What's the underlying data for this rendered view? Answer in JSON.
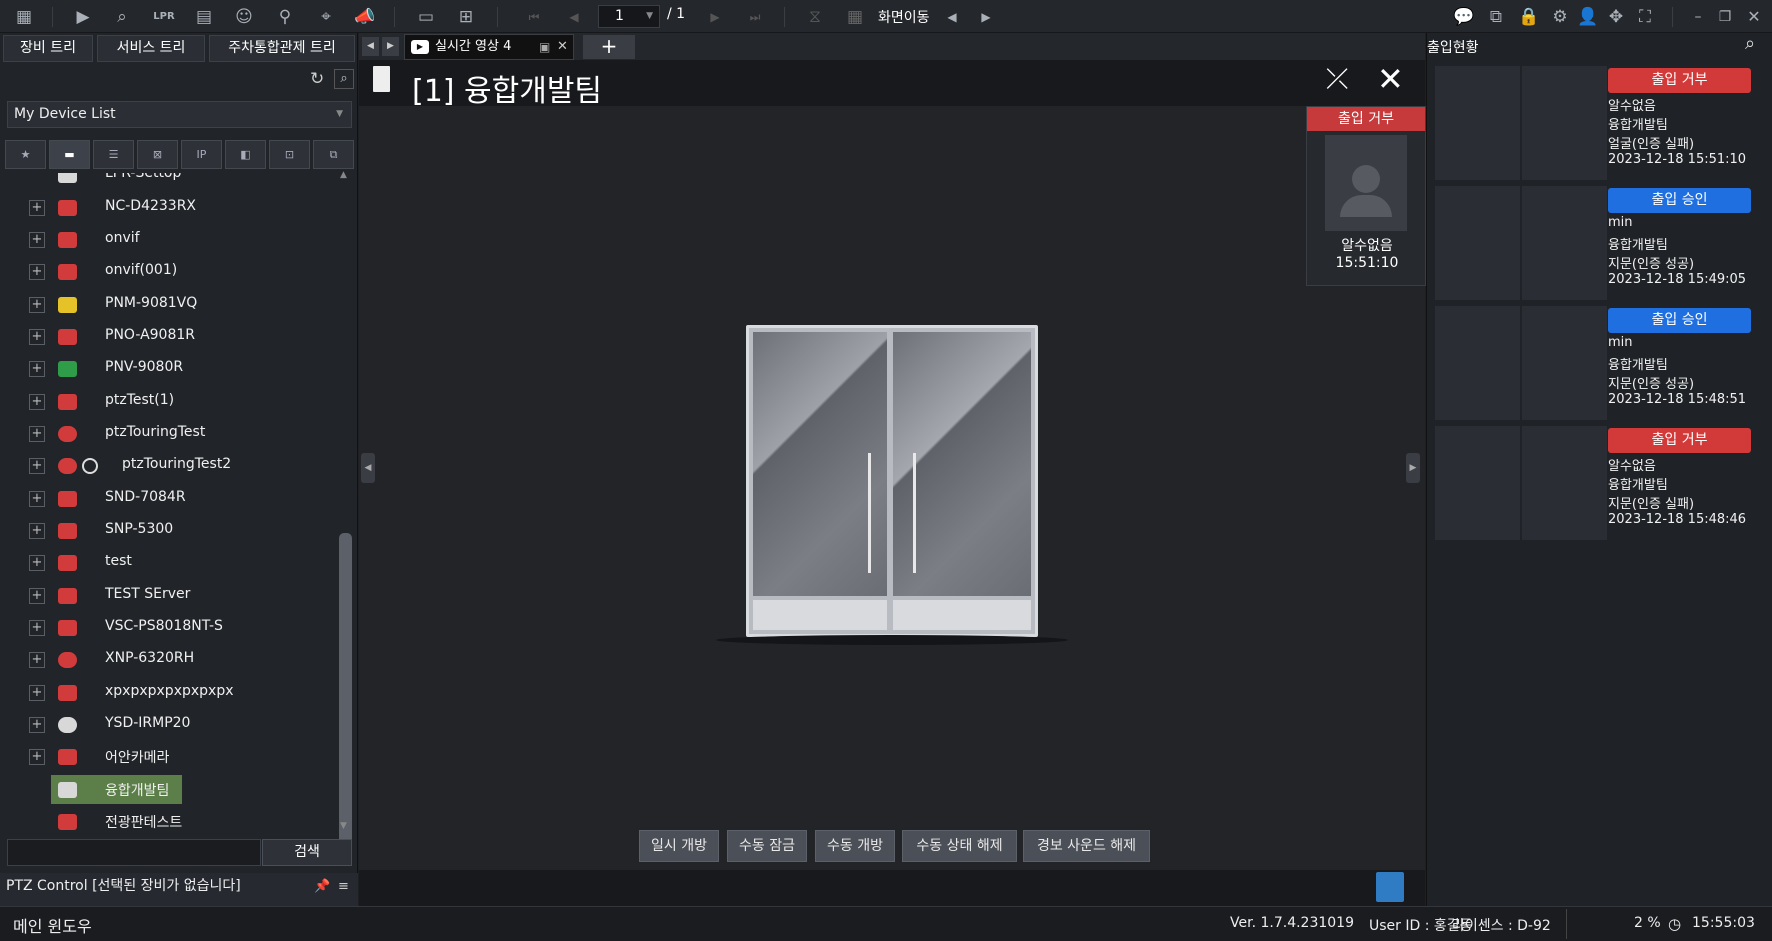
{
  "toolbar": {
    "page_current": "1",
    "page_total": "/ 1",
    "screen_move_label": "화면이동",
    "lpr_label": "LPR",
    "icons_left": [
      "grid-icon",
      "live-play-icon",
      "playback-search-icon",
      "lpr-icon",
      "event-search-icon",
      "face-search-icon",
      "bike-search-icon",
      "map-search-icon",
      "alarm-icon",
      "layout-icon",
      "add-screen-icon"
    ],
    "icons_right": [
      "chat-icon",
      "monitor-icon",
      "lock-icon",
      "gear-icon",
      "user-icon",
      "move-icon",
      "fullscreen-icon"
    ]
  },
  "left_panel": {
    "tabs": [
      "장비 트리",
      "서비스 트리",
      "주차통합관제 트리"
    ],
    "device_list_label": "My Device List",
    "filters": [
      "★",
      "folder",
      "nvr",
      "camera",
      "IP",
      "cctv",
      "ai",
      "misc"
    ],
    "tree": [
      {
        "label": "LPR-Settop",
        "color": "#d8d8d8",
        "expandable": false
      },
      {
        "label": "NC-D4233RX",
        "color": "#d23b3b",
        "expandable": true
      },
      {
        "label": "onvif",
        "color": "#d23b3b",
        "expandable": true
      },
      {
        "label": "onvif(001)",
        "color": "#d23b3b",
        "expandable": true
      },
      {
        "label": "PNM-9081VQ",
        "color": "#e6c229",
        "expandable": true
      },
      {
        "label": "PNO-A9081R",
        "color": "#d23b3b",
        "expandable": true
      },
      {
        "label": "PNV-9080R",
        "color": "#2e9c49",
        "expandable": true
      },
      {
        "label": "ptzTest(1)",
        "color": "#d23b3b",
        "expandable": true
      },
      {
        "label": "ptzTouringTest",
        "color": "#d23b3b",
        "expandable": true
      },
      {
        "label": "ptzTouringTest2",
        "color": "#d23b3b",
        "expandable": true
      },
      {
        "label": "SND-7084R",
        "color": "#d23b3b",
        "expandable": true
      },
      {
        "label": "SNP-5300",
        "color": "#d23b3b",
        "expandable": true
      },
      {
        "label": "test",
        "color": "#d23b3b",
        "expandable": true
      },
      {
        "label": "TEST SErver",
        "color": "#d23b3b",
        "expandable": true
      },
      {
        "label": "VSC-PS8018NT-S",
        "color": "#d23b3b",
        "expandable": true
      },
      {
        "label": "XNP-6320RH",
        "color": "#d23b3b",
        "expandable": true
      },
      {
        "label": "xpxpxpxpxpxpxpx",
        "color": "#d23b3b",
        "expandable": true
      },
      {
        "label": "YSD-IRMP20",
        "color": "#d8d8d8",
        "expandable": true
      },
      {
        "label": "어안카메라",
        "color": "#d23b3b",
        "expandable": true
      },
      {
        "label": "융합개발팀",
        "color": "#d8d8d8",
        "expandable": false,
        "selected": true
      },
      {
        "label": "전광판테스트",
        "color": "#d23b3b",
        "expandable": false
      }
    ],
    "search_button": "검색",
    "ptz_status": "PTZ Control [선택된 장비가 없습니다]"
  },
  "center": {
    "tab_label": "실시간 영상 4",
    "view_title": "[1] 융합개발팀",
    "deny_card": {
      "badge": "출입 거부",
      "name": "알수없음",
      "time": "15:51:10"
    },
    "controls": [
      "일시 개방",
      "수동 잠금",
      "수동 개방",
      "수동 상태 해제",
      "경보 사운드 해제"
    ]
  },
  "right_panel": {
    "title": "출입현황",
    "events": [
      {
        "badge": "출입 거부",
        "badge_color": "#d23a3a",
        "user": "알수없음",
        "group": "융합개발팀",
        "method": "얼굴(인증 실패)",
        "time": "2023-12-18 15:51:10"
      },
      {
        "badge": "출입 승인",
        "badge_color": "#1f6fe0",
        "user": "min",
        "group": "융합개발팀",
        "method": "지문(인증 성공)",
        "time": "2023-12-18 15:49:05"
      },
      {
        "badge": "출입 승인",
        "badge_color": "#1f6fe0",
        "user": "min",
        "group": "융합개발팀",
        "method": "지문(인증 성공)",
        "time": "2023-12-18 15:48:51"
      },
      {
        "badge": "출입 거부",
        "badge_color": "#d23a3a",
        "user": "알수없음",
        "group": "융합개발팀",
        "method": "지문(인증 실패)",
        "time": "2023-12-18 15:48:46"
      }
    ]
  },
  "status_bar": {
    "window_label": "메인 윈도우",
    "version": "Ver. 1.7.4.231019",
    "user": "User ID : 홍길동",
    "license": "라이센스 : D-92",
    "cpu": "2 %",
    "clock": "15:55:03"
  }
}
